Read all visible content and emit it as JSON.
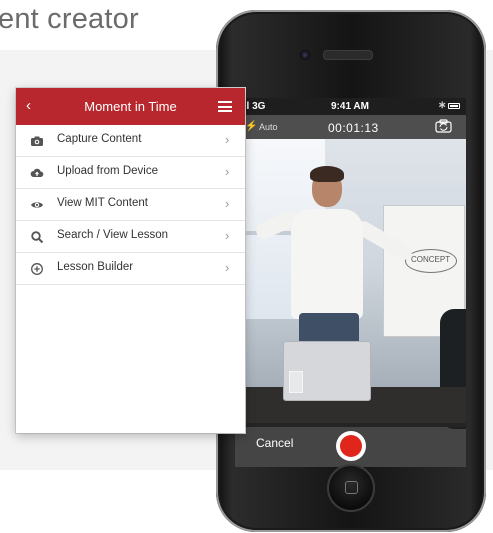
{
  "headline": "ent creator",
  "app": {
    "title": "Moment in Time",
    "back_symbol": "‹",
    "menu": [
      {
        "label": "Capture Content",
        "icon": "camera-icon"
      },
      {
        "label": "Upload from Device",
        "icon": "cloud-upload-icon"
      },
      {
        "label": "View MIT Content",
        "icon": "eye-icon"
      },
      {
        "label": "Search / View Lesson",
        "icon": "search-icon"
      },
      {
        "label": "Lesson Builder",
        "icon": "plus-circle-icon"
      }
    ],
    "chevron": "›",
    "accent": "#b8272e"
  },
  "phone": {
    "status": {
      "carrier": "ııl 3G",
      "time": "9:41 AM",
      "bluetooth": "∗"
    },
    "camera": {
      "flash_label": "Auto",
      "timer": "00:01:13",
      "cancel": "Cancel"
    },
    "whiteboard_words": "CONCEPT",
    "record_color": "#e0251b"
  }
}
